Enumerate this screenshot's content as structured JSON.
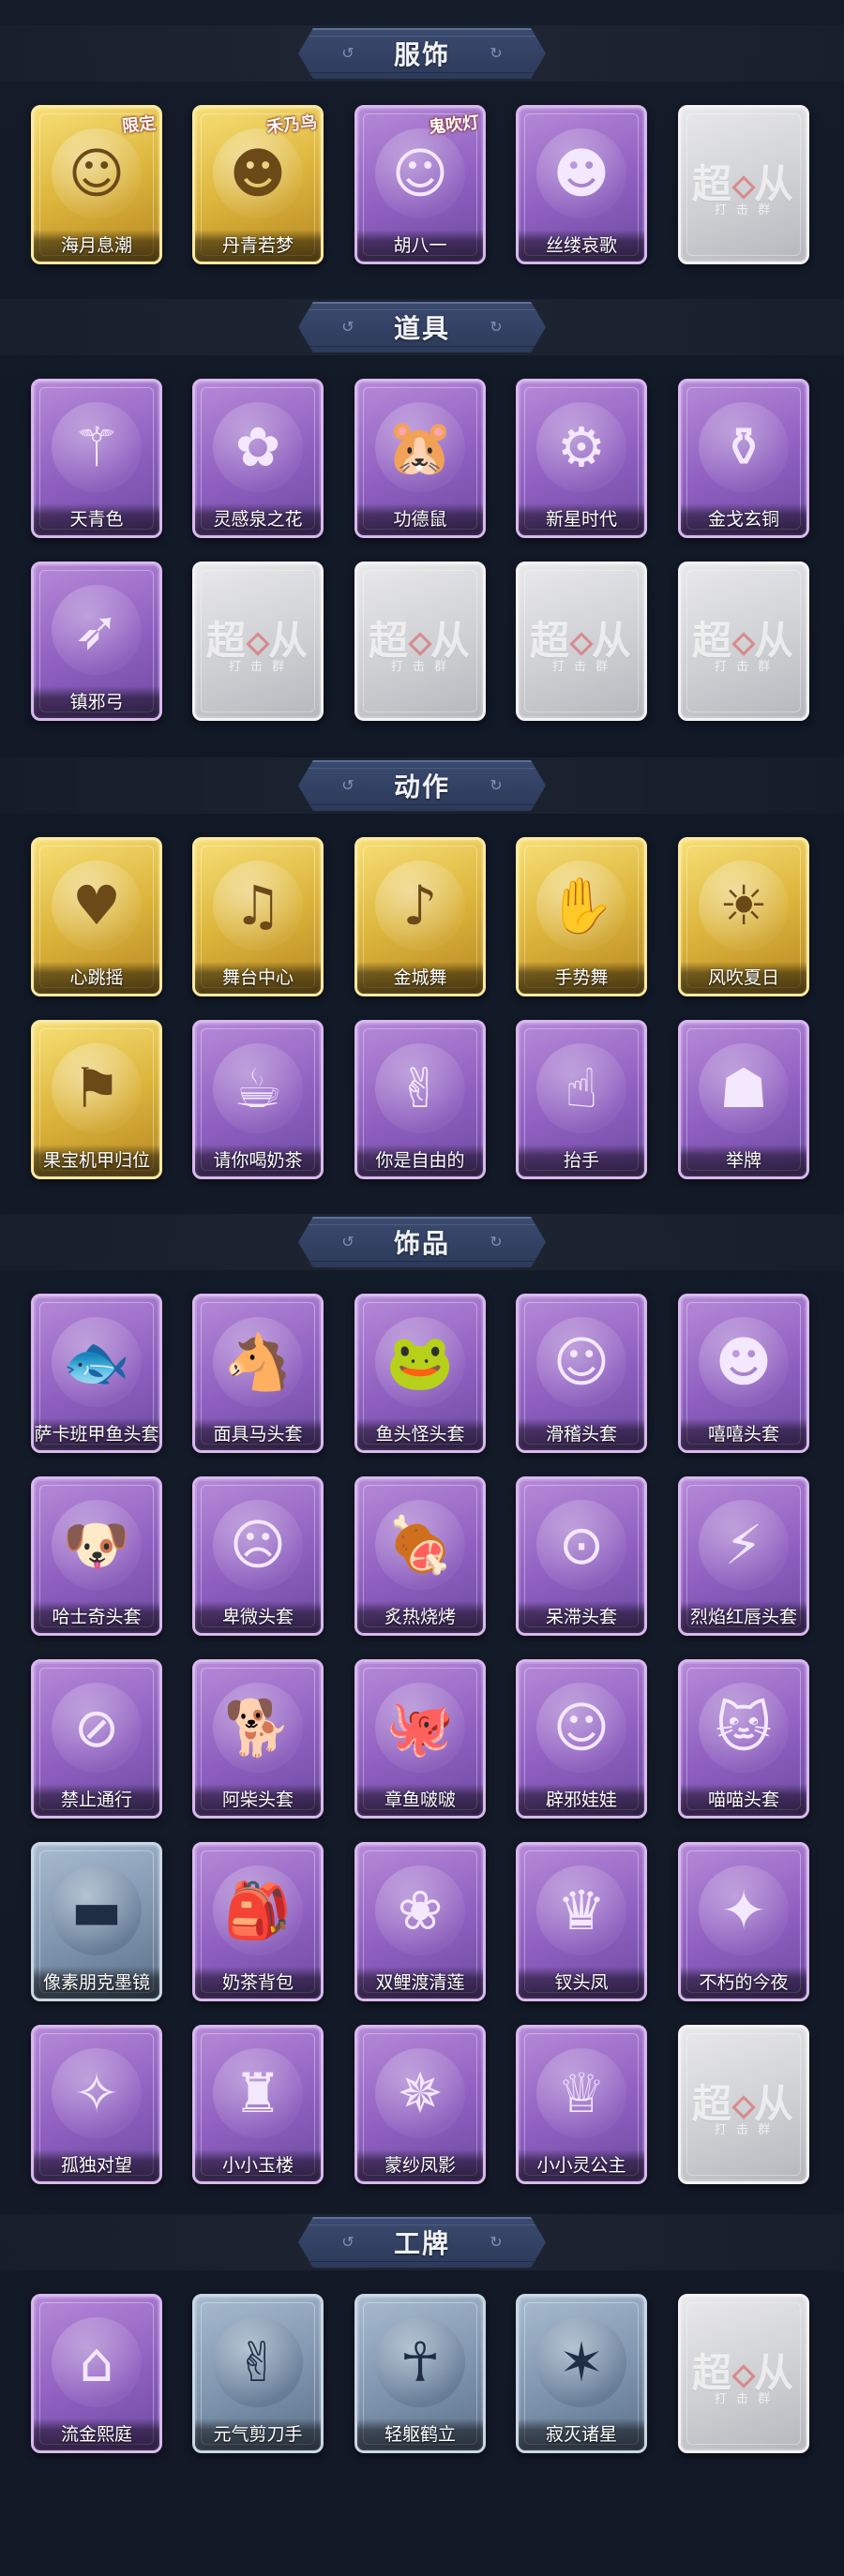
{
  "sections": [
    {
      "id": "costume",
      "title": "服饰",
      "rows": [
        [
          {
            "label": "海月息潮",
            "style": "gold",
            "icon": "☺",
            "icon_name": "siren-portrait-icon",
            "tag": "限定"
          },
          {
            "label": "丹青若梦",
            "style": "gold",
            "icon": "☻",
            "icon_name": "masked-lady-portrait-icon",
            "tag": "禾乃鸟"
          },
          {
            "label": "胡八一",
            "style": "purple",
            "icon": "☺",
            "icon_name": "young-man-portrait-icon",
            "tag": "鬼吹灯"
          },
          {
            "label": "丝缕哀歌",
            "style": "purple",
            "icon": "☻",
            "icon_name": "doll-girl-portrait-icon",
            "tag": ""
          },
          {
            "label": "",
            "style": "empty",
            "icon": "",
            "icon_name": "empty-slot-icon",
            "tag": ""
          }
        ]
      ]
    },
    {
      "id": "props",
      "title": "道具",
      "rows": [
        [
          {
            "label": "天青色",
            "style": "purple",
            "icon": "⚚",
            "icon_name": "staff-icon",
            "tag": ""
          },
          {
            "label": "灵感泉之花",
            "style": "purple",
            "icon": "✿",
            "icon_name": "bouquet-icon",
            "tag": ""
          },
          {
            "label": "功德鼠",
            "style": "purple",
            "icon": "🐹",
            "icon_name": "hamster-icon",
            "tag": ""
          },
          {
            "label": "新星时代",
            "style": "purple",
            "icon": "⚙",
            "icon_name": "revolver-icon",
            "tag": ""
          },
          {
            "label": "金戈玄铜",
            "style": "purple",
            "icon": "⚱",
            "icon_name": "grenade-icon",
            "tag": ""
          }
        ],
        [
          {
            "label": "镇邪弓",
            "style": "purple",
            "icon": "➶",
            "icon_name": "bow-icon",
            "tag": ""
          },
          {
            "label": "",
            "style": "empty",
            "icon": "",
            "icon_name": "empty-slot-icon",
            "tag": ""
          },
          {
            "label": "",
            "style": "empty",
            "icon": "",
            "icon_name": "empty-slot-icon",
            "tag": ""
          },
          {
            "label": "",
            "style": "empty",
            "icon": "",
            "icon_name": "empty-slot-icon",
            "tag": ""
          },
          {
            "label": "",
            "style": "empty",
            "icon": "",
            "icon_name": "empty-slot-icon",
            "tag": ""
          }
        ]
      ]
    },
    {
      "id": "actions",
      "title": "动作",
      "rows": [
        [
          {
            "label": "心跳摇",
            "style": "gold",
            "icon": "♥",
            "icon_name": "dance-heart-pose-icon",
            "tag": ""
          },
          {
            "label": "舞台中心",
            "style": "gold",
            "icon": "♫",
            "icon_name": "stage-pose-icon",
            "tag": ""
          },
          {
            "label": "金城舞",
            "style": "gold",
            "icon": "♪",
            "icon_name": "dance-pose-icon",
            "tag": ""
          },
          {
            "label": "手势舞",
            "style": "gold",
            "icon": "✋",
            "icon_name": "hand-gesture-pose-icon",
            "tag": ""
          },
          {
            "label": "风吹夏日",
            "style": "gold",
            "icon": "☀",
            "icon_name": "summer-wind-pose-icon",
            "tag": ""
          }
        ],
        [
          {
            "label": "果宝机甲归位",
            "style": "gold",
            "icon": "⚑",
            "icon_name": "mecha-pose-icon",
            "tag": ""
          },
          {
            "label": "请你喝奶茶",
            "style": "purple",
            "icon": "☕",
            "icon_name": "milk-tea-pose-icon",
            "tag": ""
          },
          {
            "label": "你是自由的",
            "style": "purple",
            "icon": "✌",
            "icon_name": "free-pose-icon",
            "tag": ""
          },
          {
            "label": "抬手",
            "style": "purple",
            "icon": "☝",
            "icon_name": "raise-hand-pose-icon",
            "tag": ""
          },
          {
            "label": "举牌",
            "style": "purple",
            "icon": "☗",
            "icon_name": "hold-sign-pose-icon",
            "tag": ""
          }
        ]
      ]
    },
    {
      "id": "accessories",
      "title": "饰品",
      "rows": [
        [
          {
            "label": "萨卡班甲鱼头套",
            "style": "purple",
            "icon": "🐟",
            "icon_name": "fish-head-icon",
            "tag": ""
          },
          {
            "label": "面具马头套",
            "style": "purple",
            "icon": "🐴",
            "icon_name": "horse-head-icon",
            "tag": ""
          },
          {
            "label": "鱼头怪头套",
            "style": "purple",
            "icon": "🐸",
            "icon_name": "fish-monster-head-icon",
            "tag": ""
          },
          {
            "label": "滑稽头套",
            "style": "purple",
            "icon": "☺",
            "icon_name": "funny-face-head-icon",
            "tag": ""
          },
          {
            "label": "嘻嘻头套",
            "style": "purple",
            "icon": "☻",
            "icon_name": "grin-face-head-icon",
            "tag": ""
          }
        ],
        [
          {
            "label": "哈士奇头套",
            "style": "purple",
            "icon": "🐶",
            "icon_name": "husky-head-icon",
            "tag": ""
          },
          {
            "label": "卑微头套",
            "style": "purple",
            "icon": "☹",
            "icon_name": "humble-face-head-icon",
            "tag": ""
          },
          {
            "label": "炙热烧烤",
            "style": "purple",
            "icon": "🍖",
            "icon_name": "bbq-head-icon",
            "tag": ""
          },
          {
            "label": "呆滞头套",
            "style": "purple",
            "icon": "⊙",
            "icon_name": "dazed-face-head-icon",
            "tag": ""
          },
          {
            "label": "烈焰红唇头套",
            "style": "purple",
            "icon": "⚡",
            "icon_name": "yellow-creature-head-icon",
            "tag": ""
          }
        ],
        [
          {
            "label": "禁止通行",
            "style": "purple",
            "icon": "⊘",
            "icon_name": "no-entry-cone-icon",
            "tag": ""
          },
          {
            "label": "阿柴头套",
            "style": "purple",
            "icon": "🐕",
            "icon_name": "shiba-head-icon",
            "tag": ""
          },
          {
            "label": "章鱼啵啵",
            "style": "purple",
            "icon": "🐙",
            "icon_name": "octopus-icon",
            "tag": ""
          },
          {
            "label": "辟邪娃娃",
            "style": "purple",
            "icon": "☺",
            "icon_name": "doll-head-icon",
            "tag": ""
          },
          {
            "label": "喵喵头套",
            "style": "purple",
            "icon": "🐱",
            "icon_name": "cat-head-icon",
            "tag": ""
          }
        ],
        [
          {
            "label": "像素朋克墨镜",
            "style": "blue",
            "icon": "▬",
            "icon_name": "pixel-sunglasses-icon",
            "tag": ""
          },
          {
            "label": "奶茶背包",
            "style": "purple",
            "icon": "🎒",
            "icon_name": "milk-tea-backpack-icon",
            "tag": ""
          },
          {
            "label": "双鲤渡清莲",
            "style": "purple",
            "icon": "❀",
            "icon_name": "koi-lotus-icon",
            "tag": ""
          },
          {
            "label": "钗头凤",
            "style": "purple",
            "icon": "♛",
            "icon_name": "phoenix-hairpin-icon",
            "tag": ""
          },
          {
            "label": "不朽的今夜",
            "style": "purple",
            "icon": "✦",
            "icon_name": "eternal-night-icon",
            "tag": ""
          }
        ],
        [
          {
            "label": "孤独对望",
            "style": "purple",
            "icon": "✧",
            "icon_name": "lonely-gaze-charm-icon",
            "tag": ""
          },
          {
            "label": "小小玉楼",
            "style": "purple",
            "icon": "♜",
            "icon_name": "little-tower-charm-icon",
            "tag": ""
          },
          {
            "label": "蒙纱凤影",
            "style": "purple",
            "icon": "✵",
            "icon_name": "veiled-phoenix-charm-icon",
            "tag": ""
          },
          {
            "label": "小小灵公主",
            "style": "purple",
            "icon": "♕",
            "icon_name": "little-princess-charm-icon",
            "tag": ""
          },
          {
            "label": "",
            "style": "empty",
            "icon": "",
            "icon_name": "empty-slot-icon",
            "tag": ""
          }
        ]
      ]
    },
    {
      "id": "badges",
      "title": "工牌",
      "rows": [
        [
          {
            "label": "流金熙庭",
            "style": "purple",
            "icon": "⌂",
            "icon_name": "golden-frame-badge-icon",
            "tag": ""
          },
          {
            "label": "元气剪刀手",
            "style": "blue",
            "icon": "✌",
            "icon_name": "silhouette-peace-badge-icon",
            "tag": ""
          },
          {
            "label": "轻躯鹤立",
            "style": "blue",
            "icon": "☥",
            "icon_name": "silhouette-pose-badge-icon",
            "tag": ""
          },
          {
            "label": "寂灭诸星",
            "style": "blue",
            "icon": "✶",
            "icon_name": "silhouette-star-badge-icon",
            "tag": ""
          },
          {
            "label": "",
            "style": "empty",
            "icon": "",
            "icon_name": "empty-slot-icon",
            "tag": ""
          }
        ]
      ]
    }
  ],
  "empty_slot": {
    "watermark": "超",
    "watermark_tail": "从",
    "watermark_sub": "打 击 群"
  },
  "colors": {
    "background": "#131a27",
    "banner": "#34446a",
    "gold_card": "#dcb53c",
    "purple_card": "#9b6ec8",
    "blue_card": "#7e94ad",
    "empty_card": "#d0d1d5"
  }
}
